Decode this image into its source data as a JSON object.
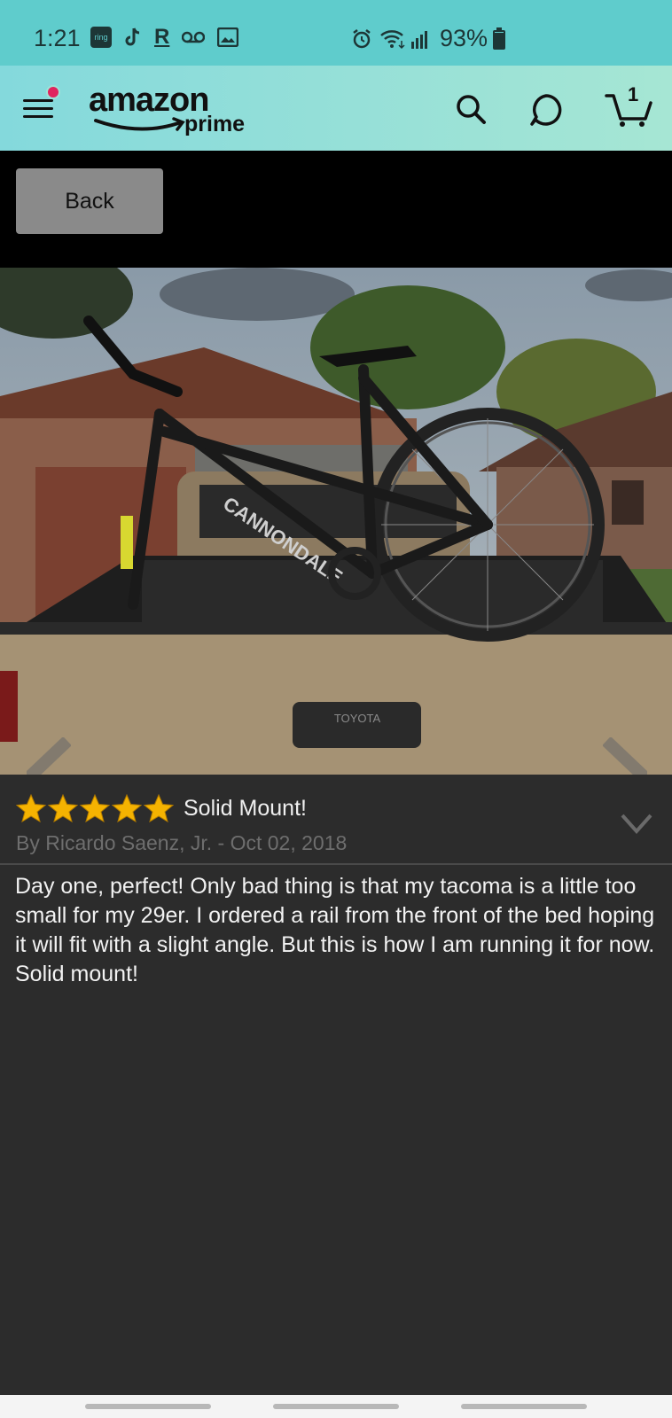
{
  "status_bar": {
    "time": "1:21",
    "left_icons": [
      "ring-icon",
      "tiktok-icon",
      "rakuten-icon",
      "voicemail-icon",
      "gallery-icon"
    ],
    "ring_label": "ring",
    "rakuten_label": "R",
    "right_icons": [
      "alarm-icon",
      "wifi-icon",
      "signal-icon"
    ],
    "battery_percent": "93%",
    "battery_level": 0.93
  },
  "header": {
    "logo_amazon": "amazon",
    "logo_prime": "prime",
    "cart_count": "1",
    "colors": {
      "gradient_start": "#84d9dc",
      "gradient_end": "#a6e6d4",
      "notification_dot": "#e0245e"
    }
  },
  "toolbar": {
    "back_label": "Back"
  },
  "review": {
    "rating": 5,
    "max_rating": 5,
    "title": "Solid Mount!",
    "meta": "By Ricardo Saenz, Jr. - Oct 02, 2018",
    "body": "Day one, perfect! Only bad thing is that my tacoma is a little too small for my 29er. I ordered a rail from the front of the bed hoping it will fit with a slight angle. But this is how I am running it for now. Solid mount!",
    "star_color": "#f5b301"
  },
  "photo": {
    "tailgate_badge": "TOYOTA",
    "frame_text": "CANNONDALE"
  }
}
